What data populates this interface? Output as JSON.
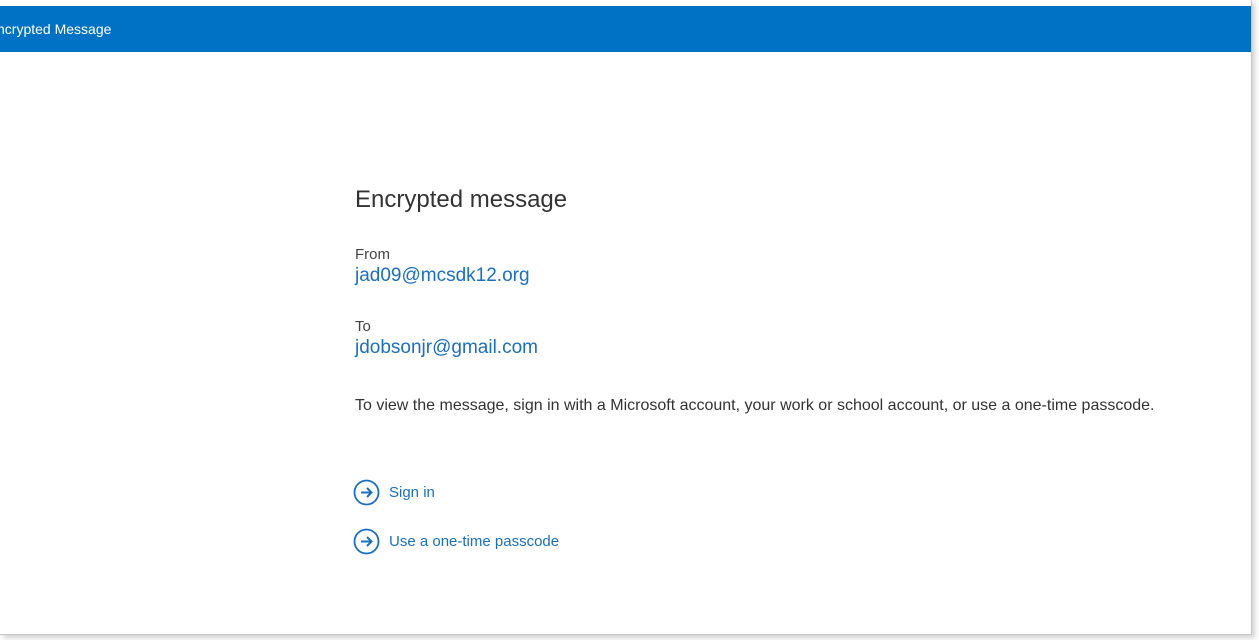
{
  "header": {
    "title": "ncrypted Message",
    "bar_color": "#0072c6"
  },
  "main": {
    "heading": "Encrypted message",
    "from_label": "From",
    "from_value": "jad09@mcsdk12.org",
    "to_label": "To",
    "to_value": "jdobsonjr@gmail.com",
    "instructions": "To view the message, sign in with a Microsoft account, your work or school account, or use a one-time passcode.",
    "actions": [
      {
        "label": "Sign in",
        "icon": "arrow-right-circle-icon"
      },
      {
        "label": "Use a one-time passcode",
        "icon": "arrow-right-circle-icon"
      }
    ],
    "link_color": "#1a6fc2"
  }
}
